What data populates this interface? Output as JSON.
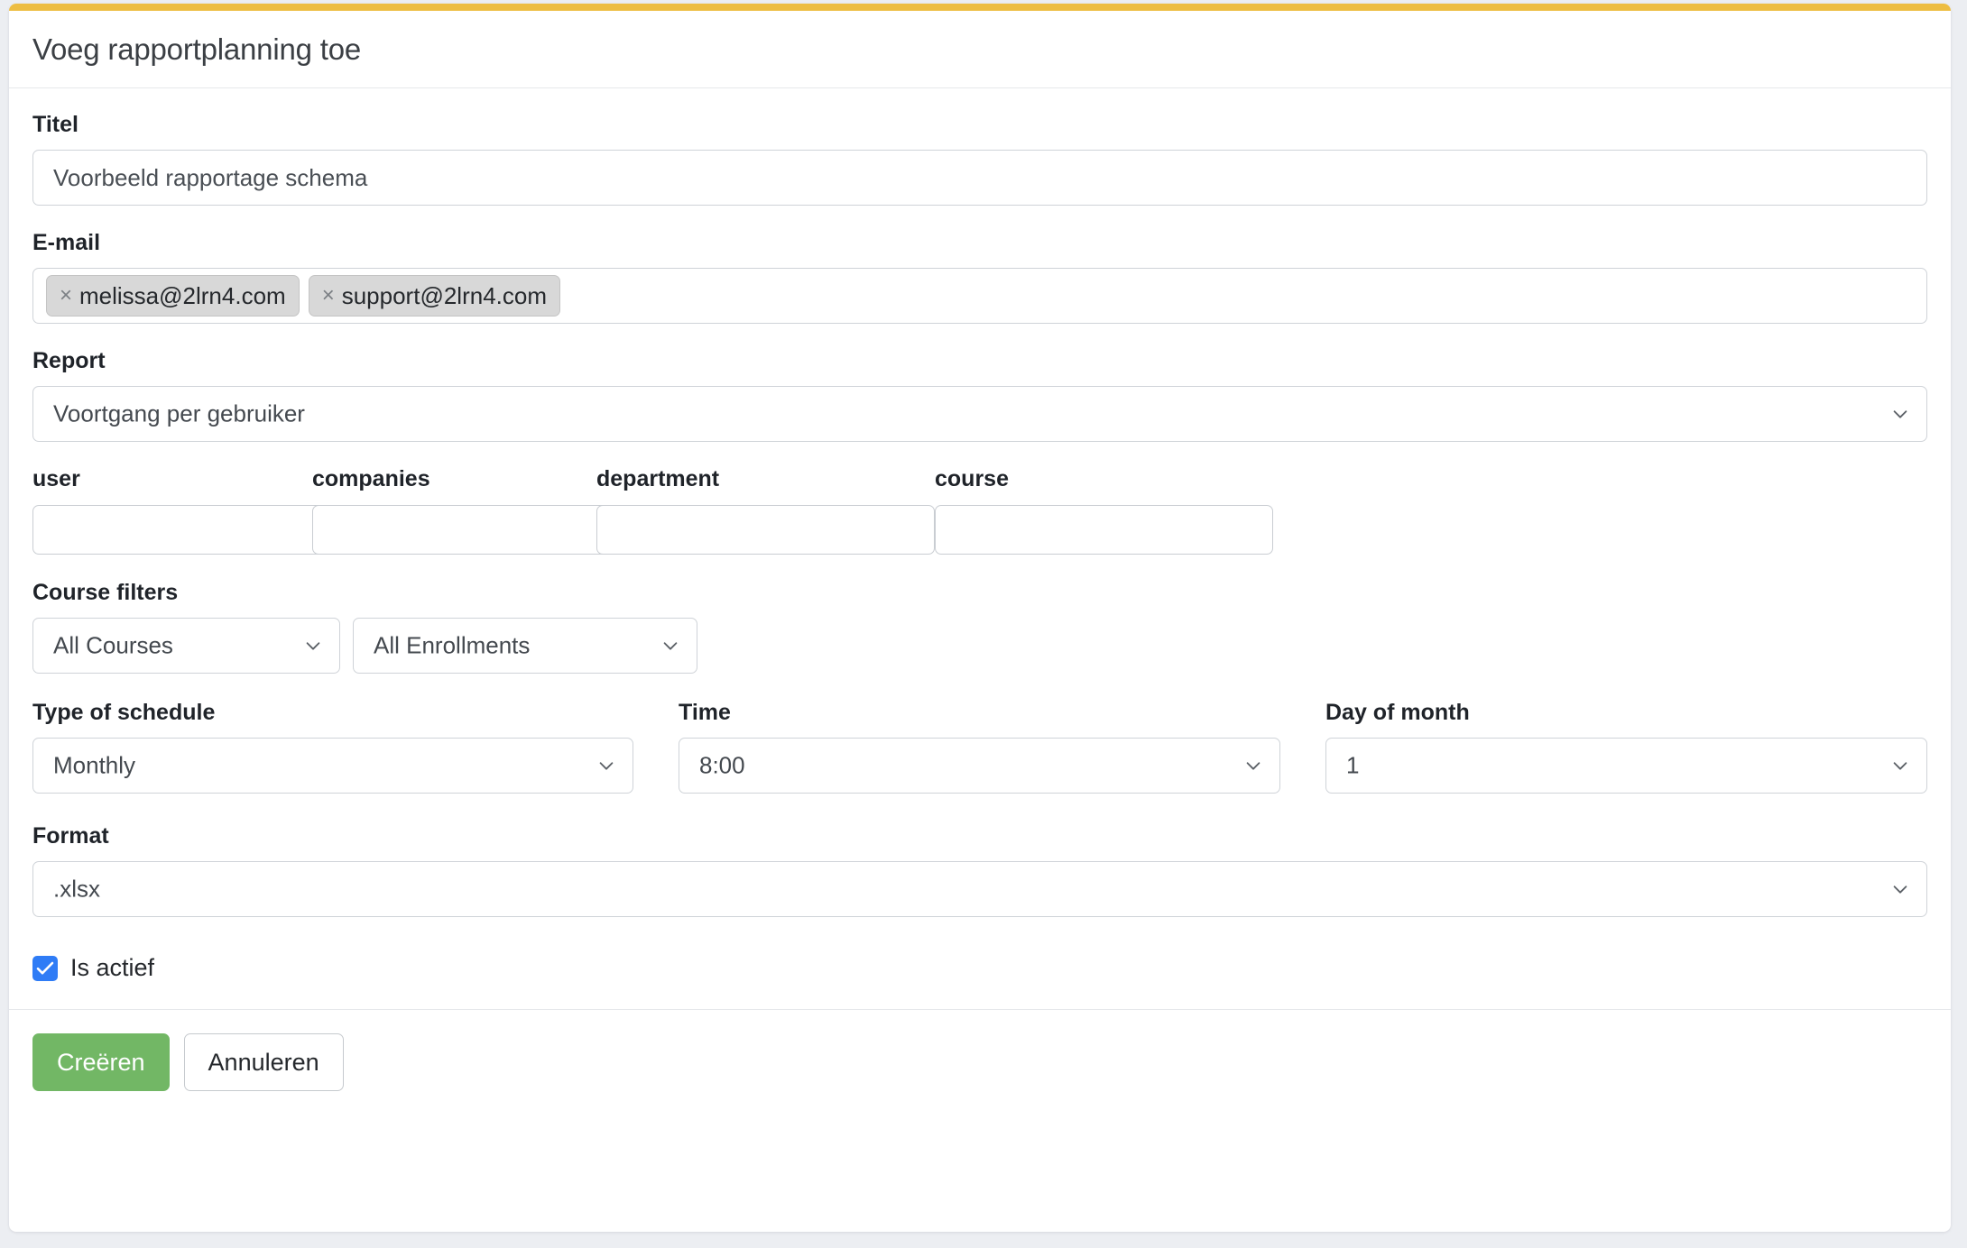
{
  "theme": {
    "accent_bar_color": "#edbd42",
    "page_background": "#eceef2",
    "primary_button_color": "#72b765",
    "checkbox_color": "#2f7cf6",
    "tag_background": "#d8d8d8"
  },
  "header": {
    "title": "Voeg rapportplanning toe"
  },
  "form": {
    "title_field": {
      "label": "Titel",
      "value": "Voorbeeld rapportage schema",
      "placeholder": ""
    },
    "email_field": {
      "label": "E-mail",
      "tags": [
        {
          "text": "melissa@2lrn4.com",
          "remove_icon": "close-icon"
        },
        {
          "text": "support@2lrn4.com",
          "remove_icon": "close-icon"
        }
      ]
    },
    "report_field": {
      "label": "Report",
      "value": "Voortgang per gebruiker",
      "chevron_icon": "chevron-down-icon"
    },
    "entity_filters": {
      "columns": [
        {
          "label": "user",
          "value": "",
          "placeholder": ""
        },
        {
          "label": "companies",
          "value": "",
          "placeholder": ""
        },
        {
          "label": "department",
          "value": "",
          "placeholder": ""
        },
        {
          "label": "course",
          "value": "",
          "placeholder": ""
        }
      ]
    },
    "course_filters": {
      "label": "Course filters",
      "selects": [
        {
          "value": "All Courses",
          "chevron_icon": "chevron-down-icon"
        },
        {
          "value": "All Enrollments",
          "chevron_icon": "chevron-down-icon"
        }
      ]
    },
    "schedule": {
      "type": {
        "label": "Type of schedule",
        "value": "Monthly",
        "chevron_icon": "chevron-down-icon"
      },
      "time": {
        "label": "Time",
        "value": "8:00",
        "chevron_icon": "chevron-down-icon"
      },
      "day_of_month": {
        "label": "Day of month",
        "value": "1",
        "chevron_icon": "chevron-down-icon"
      }
    },
    "format_field": {
      "label": "Format",
      "value": ".xlsx",
      "chevron_icon": "chevron-down-icon"
    },
    "is_active": {
      "label": "Is actief",
      "checked": true
    }
  },
  "footer": {
    "create_label": "Creëren",
    "cancel_label": "Annuleren"
  }
}
